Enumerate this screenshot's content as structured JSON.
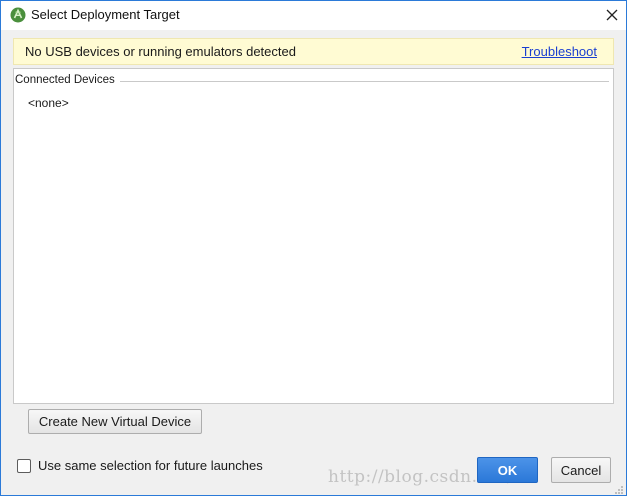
{
  "window": {
    "title": "Select Deployment Target",
    "icon": "android-studio-icon",
    "close_icon": "close-icon"
  },
  "banner": {
    "message": "No USB devices or running emulators detected",
    "link_label": "Troubleshoot"
  },
  "devices": {
    "section_label": "Connected Devices",
    "items": [
      "<none>"
    ]
  },
  "buttons": {
    "create_label": "Create New Virtual Device",
    "ok_label": "OK",
    "cancel_label": "Cancel"
  },
  "options": {
    "same_selection_label": "Use same selection for future launches",
    "same_selection_checked": false
  },
  "watermark": "http://blog.csdn.net/...",
  "colors": {
    "accent": "#2b78d8",
    "banner_bg": "#fffbd3",
    "link": "#1a3fd1"
  }
}
